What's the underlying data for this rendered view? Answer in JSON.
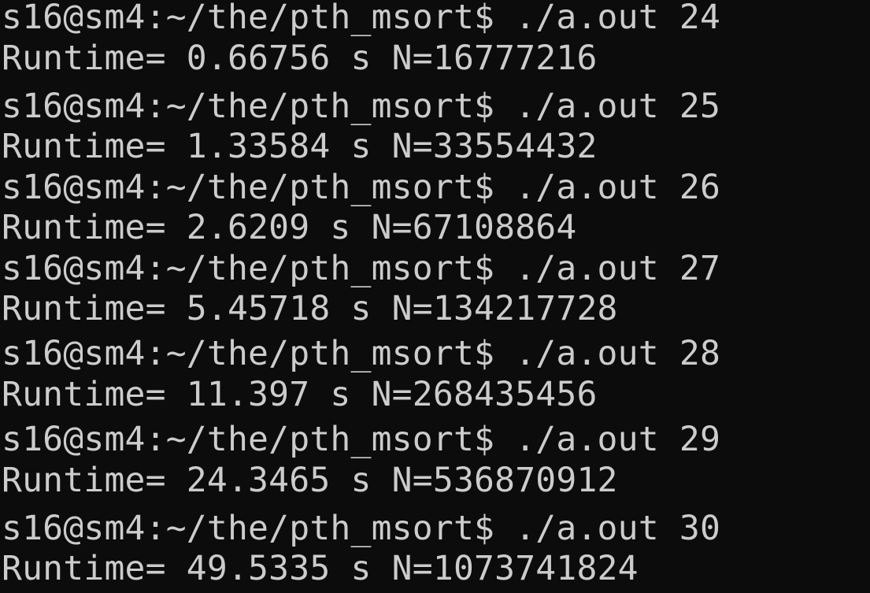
{
  "terminal": {
    "lines": [
      "s16@sm4:~/the/pth_msort$ ./a.out 24",
      "Runtime= 0.66756 s N=16777216",
      "s16@sm4:~/the/pth_msort$ ./a.out 25",
      "Runtime= 1.33584 s N=33554432",
      "s16@sm4:~/the/pth_msort$ ./a.out 26",
      "Runtime= 2.6209 s N=67108864",
      "s16@sm4:~/the/pth_msort$ ./a.out 27",
      "Runtime= 5.45718 s N=134217728",
      "s16@sm4:~/the/pth_msort$ ./a.out 28",
      "Runtime= 11.397 s N=268435456",
      "s16@sm4:~/the/pth_msort$ ./a.out 29",
      "Runtime= 24.3465 s N=536870912",
      "s16@sm4:~/the/pth_msort$ ./a.out 30",
      "Runtime= 49.5335 s N=1073741824"
    ],
    "colors": {
      "background": "#0c0c0c",
      "foreground": "#cccccc"
    }
  }
}
